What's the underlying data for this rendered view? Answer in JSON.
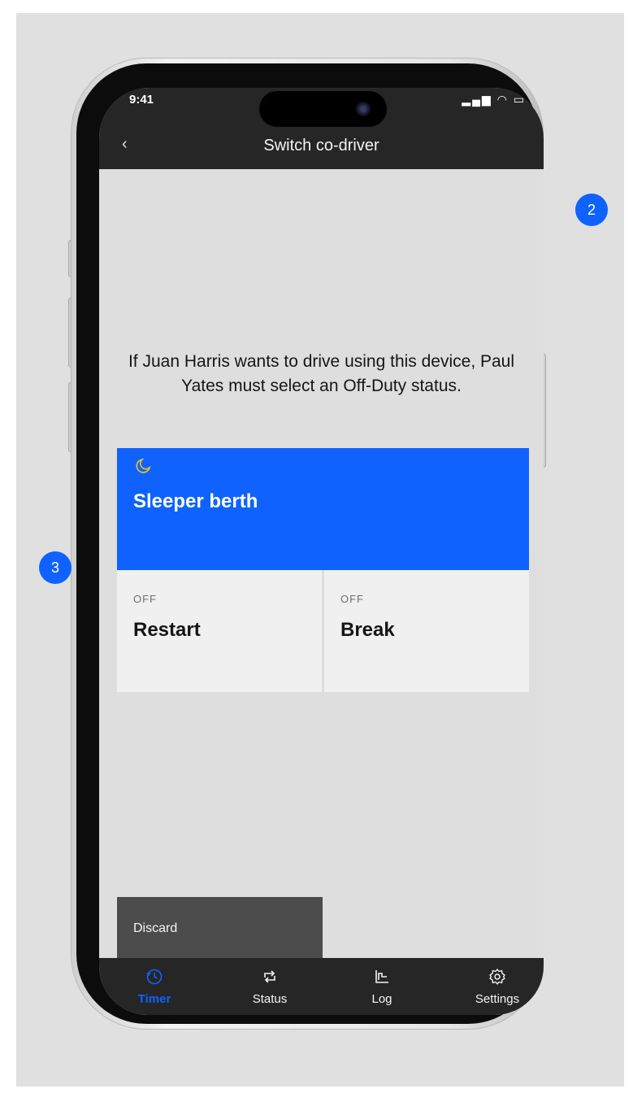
{
  "status_bar": {
    "time": "9:41"
  },
  "header": {
    "back_glyph": "‹",
    "title": "Switch co-driver"
  },
  "message": "If Juan Harris wants to drive using this device, Paul Yates must select an Off-Duty status.",
  "options": {
    "sleeper": {
      "icon": "moon-icon",
      "label": "Sleeper berth",
      "color": "#0f62fe"
    },
    "restart": {
      "tag": "OFF",
      "label": "Restart"
    },
    "break": {
      "tag": "OFF",
      "label": "Break"
    }
  },
  "discard": {
    "label": "Discard"
  },
  "tabs": [
    {
      "label": "Timer",
      "icon": "timer-icon",
      "active": true
    },
    {
      "label": "Status",
      "icon": "switch-arrows-icon",
      "active": false
    },
    {
      "label": "Log",
      "icon": "log-chart-icon",
      "active": false
    },
    {
      "label": "Settings",
      "icon": "gear-icon",
      "active": false
    }
  ],
  "annotations": {
    "badge_2": "2",
    "badge_3": "3"
  }
}
